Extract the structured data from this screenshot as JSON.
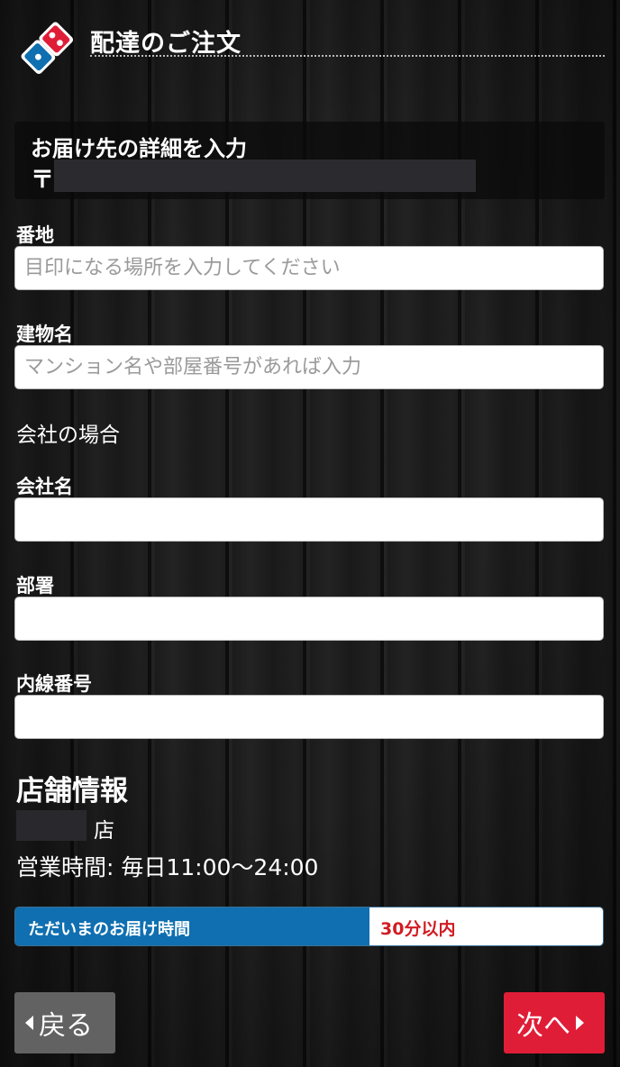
{
  "header": {
    "title": "配達のご注文"
  },
  "address": {
    "title": "お届け先の詳細を入力",
    "postal_mark": "〒"
  },
  "form": {
    "street": {
      "label": "番地",
      "placeholder": "目印になる場所を入力してください",
      "value": ""
    },
    "building": {
      "label": "建物名",
      "placeholder": "マンション名や部屋番号があれば入力",
      "value": ""
    },
    "company_section": "会社の場合",
    "company": {
      "label": "会社名",
      "value": ""
    },
    "department": {
      "label": "部署",
      "value": ""
    },
    "extension": {
      "label": "内線番号",
      "value": ""
    }
  },
  "store": {
    "heading": "店舗情報",
    "name_suffix": "店",
    "hours": "営業時間: 毎日11:00〜24:00"
  },
  "delivery": {
    "label": "ただいまのお届け時間",
    "value": "30分以内"
  },
  "buttons": {
    "back": "戻る",
    "next": "次へ"
  },
  "colors": {
    "brand_blue": "#0f6fb0",
    "brand_red": "#e01d37",
    "time_red": "#d21b22",
    "back_gray": "#626262"
  },
  "icons": {
    "logo": "dominos-logo-icon"
  }
}
